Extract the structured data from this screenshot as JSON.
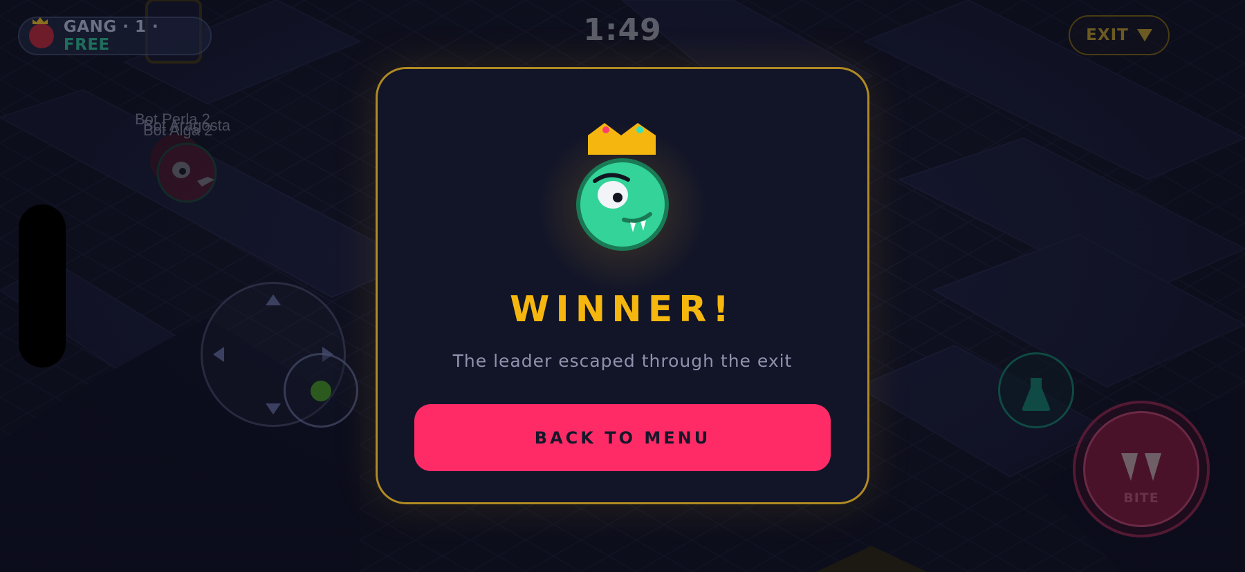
{
  "hud": {
    "gang_label": "GANG · 1 ·",
    "gang_status": "FREE",
    "timer": "1:49",
    "exit_label": "EXIT"
  },
  "bots": {
    "names": [
      "Bot Perla 2",
      "Bot Aragosta",
      "Bot Alga 2"
    ]
  },
  "modal": {
    "title": "WINNER!",
    "subtitle": "The leader escaped through the exit",
    "back_button": "BACK TO MENU"
  },
  "controls": {
    "bite_label": "BITE"
  },
  "colors": {
    "accent_gold": "#f5b70f",
    "primary_button": "#fe2b67",
    "modal_bg": "#121528",
    "winner_green": "#33d39a",
    "free_green": "#1f6d5b"
  },
  "icons": {
    "winner": "green-monster-avatar-with-crown",
    "potion": "flask-icon",
    "bite": "fangs-icon",
    "exit": "down-arrow-icon"
  }
}
